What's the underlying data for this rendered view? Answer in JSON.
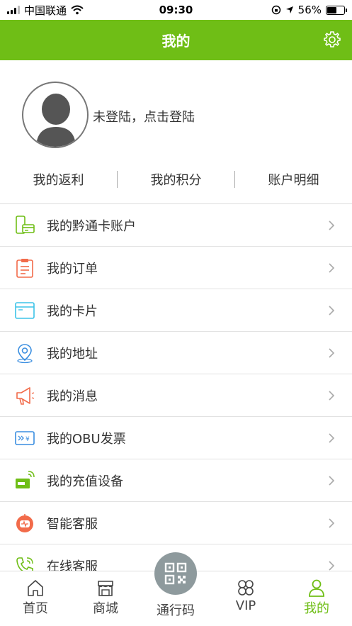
{
  "status_bar": {
    "carrier": "中国联通",
    "time": "09:30",
    "battery": "56%"
  },
  "header": {
    "title": "我的"
  },
  "profile": {
    "login_prompt": "未登陆，点击登陆"
  },
  "stats": [
    "我的返利",
    "我的积分",
    "账户明细"
  ],
  "menu": [
    {
      "label": "我的黔通卡账户",
      "icon": "card-account-icon"
    },
    {
      "label": "我的订单",
      "icon": "order-icon"
    },
    {
      "label": "我的卡片",
      "icon": "card-icon"
    },
    {
      "label": "我的地址",
      "icon": "location-icon"
    },
    {
      "label": "我的消息",
      "icon": "megaphone-icon"
    },
    {
      "label": "我的OBU发票",
      "icon": "invoice-icon"
    },
    {
      "label": "我的充值设备",
      "icon": "recharge-device-icon"
    },
    {
      "label": "智能客服",
      "icon": "robot-icon"
    },
    {
      "label": "在线客服",
      "icon": "phone-icon"
    }
  ],
  "tabbar": {
    "home": "首页",
    "mall": "商城",
    "pass_code": "通行码",
    "vip": "VIP",
    "mine": "我的"
  },
  "colors": {
    "brand_green": "#6fbe16",
    "qr_button": "#8e9a9d"
  }
}
